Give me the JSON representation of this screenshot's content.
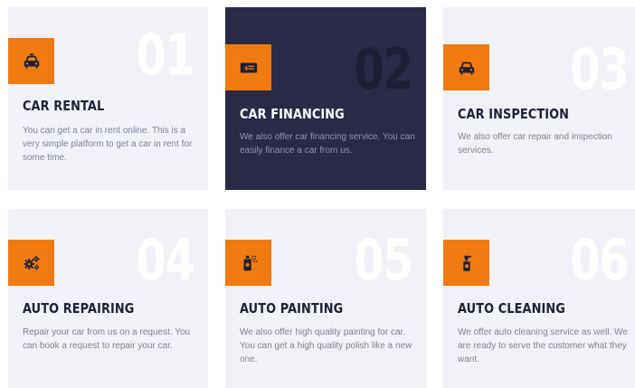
{
  "services": [
    {
      "number": "01",
      "title": "CAR RENTAL",
      "description": "You can get a car in rent online. This is a very simple platform to get a car in rent for some time.",
      "icon": "car-icon"
    },
    {
      "number": "02",
      "title": "CAR FINANCING",
      "description": "We also offer car financing service. You can easily finance a car from us.",
      "icon": "money-icon"
    },
    {
      "number": "03",
      "title": "CAR INSPECTION",
      "description": "We also offer car repair and inspection services.",
      "icon": "car-icon"
    },
    {
      "number": "04",
      "title": "AUTO REPAIRING",
      "description": "Repair your car from us on a request. You can book a request to repair your car.",
      "icon": "gears-icon"
    },
    {
      "number": "05",
      "title": "AUTO PAINTING",
      "description": "We also offer high quality painting for car. You can get a high quality polish like a new one.",
      "icon": "spray-paint-icon"
    },
    {
      "number": "06",
      "title": "AUTO CLEANING",
      "description": "We offer auto cleaning service as well. We are ready to serve the customer what they want.",
      "icon": "spray-bottle-icon"
    }
  ],
  "colors": {
    "accent": "#f07a12",
    "card_background": "#f1f2f7",
    "card_active_background": "#282a46",
    "title": "#1f2236",
    "text": "#7e8196"
  }
}
